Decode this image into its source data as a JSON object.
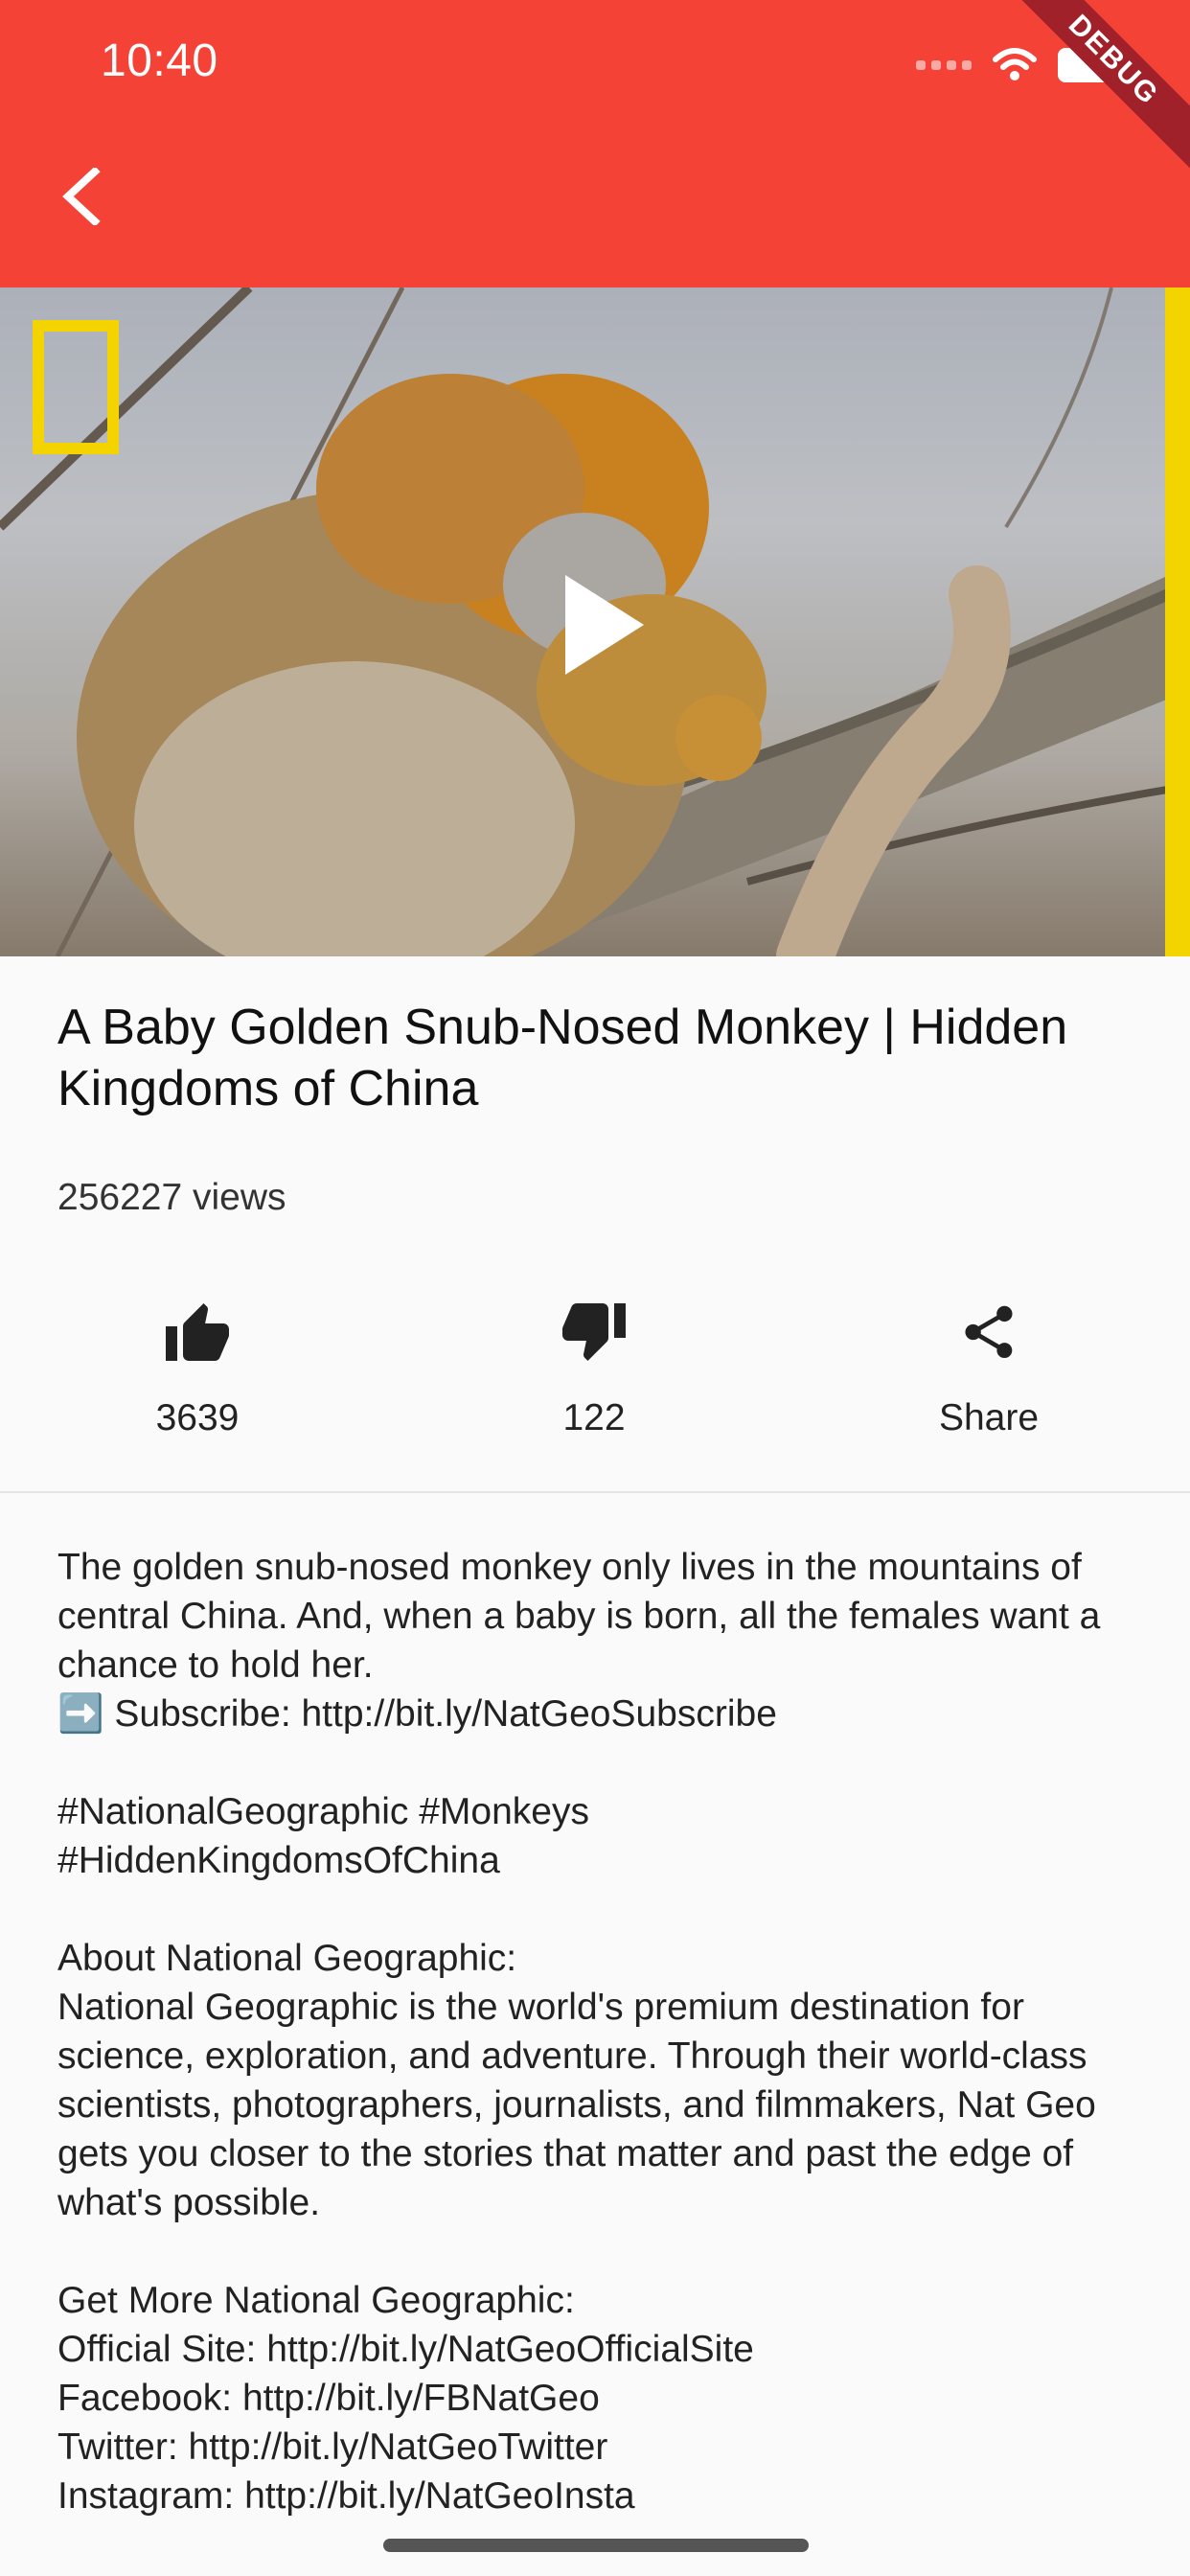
{
  "status_bar": {
    "time": "10:40",
    "debug_banner": "DEBUG"
  },
  "app_bar": {
    "back_icon": "back-arrow-icon"
  },
  "video": {
    "play_icon": "play-icon",
    "logo": "national-geographic-logo"
  },
  "video_info": {
    "title": "A Baby Golden Snub-Nosed Monkey | Hidden Kingdoms of China",
    "views": "256227 views"
  },
  "actions": {
    "like": {
      "icon": "thumbs-up-icon",
      "label": "3639"
    },
    "dislike": {
      "icon": "thumbs-down-icon",
      "label": "122"
    },
    "share": {
      "icon": "share-icon",
      "label": "Share"
    }
  },
  "description": "The golden snub-nosed monkey only lives in the mountains of central China. And, when a baby is born, all the females want a chance to hold her.\n➡️ Subscribe: http://bit.ly/NatGeoSubscribe\n\n#NationalGeographic #Monkeys\n#HiddenKingdomsOfChina\n\nAbout National Geographic:\nNational Geographic is the world's premium destination for science, exploration, and adventure. Through their world-class scientists, photographers, journalists, and filmmakers, Nat Geo gets you closer to the stories that matter and past the edge of what's possible.\n\nGet More National Geographic:\nOfficial Site: http://bit.ly/NatGeoOfficialSite\nFacebook: http://bit.ly/FBNatGeo\nTwitter: http://bit.ly/NatGeoTwitter\nInstagram: http://bit.ly/NatGeoInsta",
  "colors": {
    "app_bar": "#f44336",
    "background": "#fafafa",
    "ng_yellow": "#f4d400"
  }
}
